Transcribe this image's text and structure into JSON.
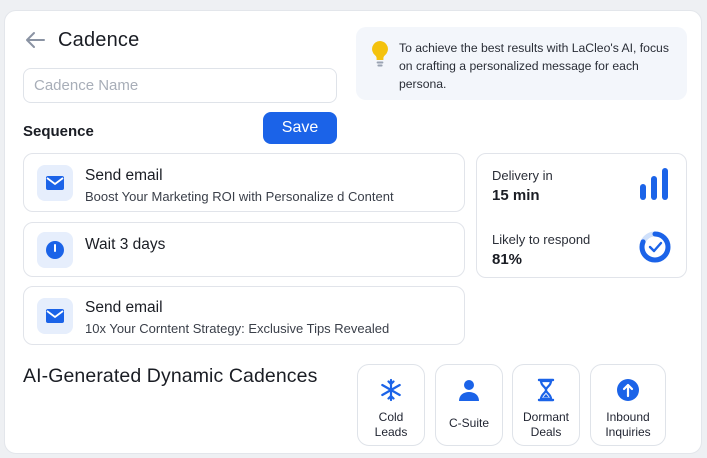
{
  "header": {
    "title": "Cadence"
  },
  "cadence_name": {
    "placeholder": "Cadence Name",
    "value": ""
  },
  "tip": {
    "text": "To achieve the best results with LaCleo's AI, focus on crafting a personalized message for each persona."
  },
  "sequence": {
    "label": "Sequence",
    "save_label": "Save",
    "steps": [
      {
        "title": "Send email",
        "subtitle": "Boost Your Marketing ROI with Personalize d Content",
        "icon": "mail-icon"
      },
      {
        "title": "Wait 3 days",
        "subtitle": "",
        "icon": "clock-icon"
      },
      {
        "title": "Send email",
        "subtitle": "10x Your Corntent Strategy: Exclusive Tips Revealed",
        "icon": "mail-icon"
      }
    ]
  },
  "stats": {
    "delivery_label": "Delivery in",
    "delivery_value": "15 min",
    "respond_label": "Likely to respond",
    "respond_value": "81%",
    "respond_fraction": 0.81
  },
  "ai_section": {
    "title": "AI-Generated Dynamic Cadences",
    "cards": [
      {
        "line1": "Cold",
        "line2": "Leads",
        "icon": "snowflake-icon"
      },
      {
        "line1": "C-Suite",
        "line2": "",
        "icon": "person-icon"
      },
      {
        "line1": "Dormant",
        "line2": "Deals",
        "icon": "hourglass-icon"
      },
      {
        "line1": "Inbound",
        "line2": "Inquiries",
        "icon": "arrow-up-circle-icon"
      }
    ]
  },
  "colors": {
    "accent": "#1b63e8",
    "icon_bg": "#e6eefc",
    "tip_bg": "#f3f6fb",
    "bulb": "#f4c20d"
  }
}
